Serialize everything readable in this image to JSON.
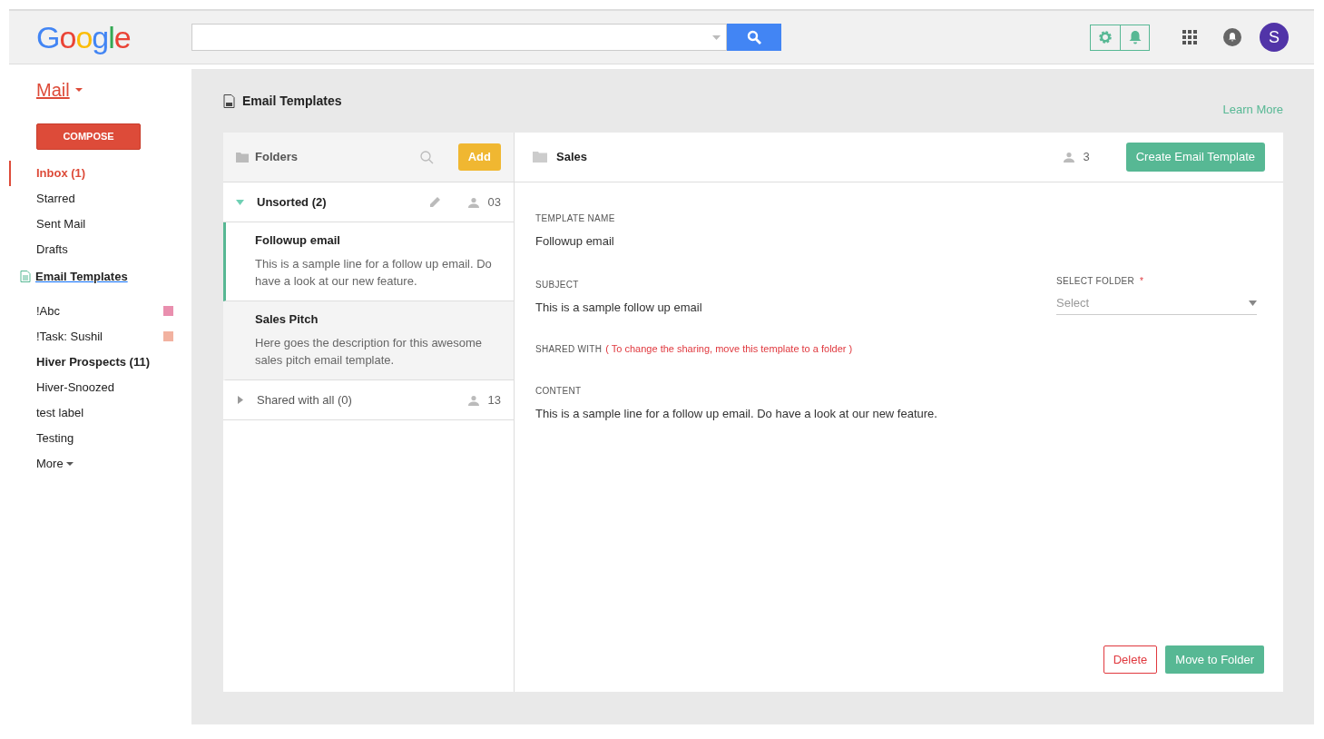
{
  "header": {
    "logo": "Google",
    "avatar": "S"
  },
  "sidebar": {
    "app": "Mail",
    "compose": "COMPOSE",
    "nav": [
      {
        "label": "Inbox (1)",
        "selected": true
      },
      {
        "label": "Starred",
        "selected": false
      },
      {
        "label": "Sent Mail",
        "selected": false
      },
      {
        "label": "Drafts",
        "selected": false
      }
    ],
    "templates_link": "Email Templates",
    "labels": [
      {
        "label": "!Abc",
        "unread": false,
        "color": "#e98fae"
      },
      {
        "label": "!Task: Sushil",
        "unread": false,
        "color": "#f2b2a0"
      },
      {
        "label": "Hiver Prospects (11)",
        "unread": true
      },
      {
        "label": "Hiver-Snoozed",
        "unread": false
      },
      {
        "label": "test label",
        "unread": false
      },
      {
        "label": "Testing",
        "unread": false
      }
    ],
    "more": "More"
  },
  "main": {
    "title": "Email Templates",
    "learn_more": "Learn More",
    "folders_panel": {
      "title": "Folders",
      "add": "Add",
      "folders": [
        {
          "name": "Unsorted (2)",
          "expanded": true,
          "editable": true,
          "count": "03",
          "templates": [
            {
              "title": "Followup email",
              "description": "This is a sample line for a follow up email. Do have a look at our new feature.",
              "selected": true
            },
            {
              "title": "Sales Pitch",
              "description": "Here goes the description for this awesome sales pitch email template.",
              "selected": false
            }
          ]
        },
        {
          "name": "Shared with all (0)",
          "expanded": false,
          "editable": false,
          "count": "13"
        }
      ]
    },
    "detail": {
      "folder": "Sales",
      "count": "3",
      "create": "Create Email Template",
      "template_name": {
        "label": "TEMPLATE NAME",
        "value": "Followup email"
      },
      "subject": {
        "label": "SUBJECT",
        "value": "This is a sample follow up email"
      },
      "select_folder": {
        "label": "SELECT FOLDER",
        "required": true,
        "required_mark": "*",
        "placeholder": "Select"
      },
      "shared_with": {
        "label": "SHARED WITH",
        "note": "( To change the sharing, move this template to a folder )"
      },
      "content": {
        "label": "CONTENT",
        "value": "This is a sample line for a follow up email. Do have a look at our new feature."
      },
      "delete": "Delete",
      "move": "Move to Folder"
    }
  }
}
